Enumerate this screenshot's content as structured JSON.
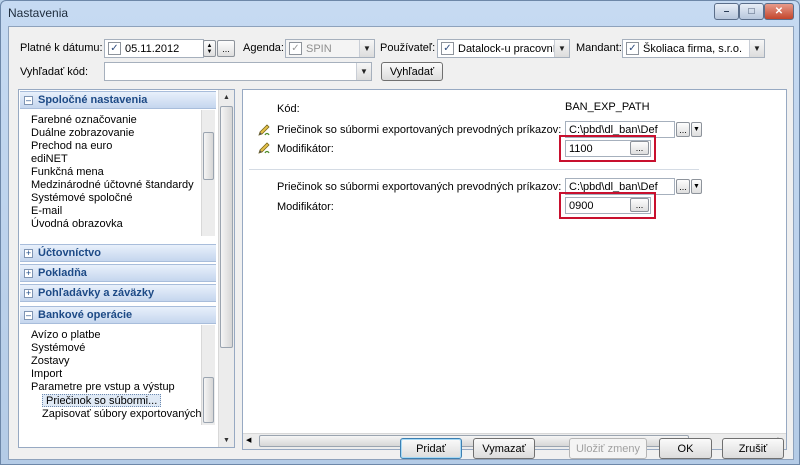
{
  "window": {
    "title": "Nastavenia"
  },
  "toolbar": {
    "valid_date_label": "Platné k dátumu:",
    "valid_date_value": "05.11.2012",
    "agenda_label": "Agenda:",
    "agenda_value": "SPIN",
    "user_label": "Používateľ:",
    "user_value": "Datalock-u pracovník",
    "mandant_label": "Mandant:",
    "mandant_value": "Školiaca firma, s.r.o.",
    "search_label": "Vyhľadať kód:",
    "search_value": "",
    "search_button": "Vyhľadať",
    "ellipsis": "..."
  },
  "nav": {
    "sections": [
      {
        "label": "Spoločné nastavenia",
        "expanded": true
      },
      {
        "label": "Účtovníctvo",
        "expanded": false
      },
      {
        "label": "Pokladňa",
        "expanded": false
      },
      {
        "label": "Pohľadávky a záväzky",
        "expanded": false
      },
      {
        "label": "Bankové operácie",
        "expanded": true
      }
    ],
    "common_items": [
      "Farebné označovanie",
      "Duálne zobrazovanie",
      "Prechod na euro",
      "ediNET",
      "Funkčná mena",
      "Medzinárodné účtovné štandardy",
      "Systémové spoločné",
      "E-mail",
      "Úvodná obrazovka"
    ],
    "bank_items": [
      "Avízo o platbe",
      "Systémové",
      "Zostavy",
      "Import",
      "Parametre pre vstup a výstup"
    ],
    "bank_subitems": [
      "Priečinok so súbormi...",
      "Zapisovať súbory exportovaných..."
    ]
  },
  "detail": {
    "code_label": "Kód:",
    "code_value": "BAN_EXP_PATH",
    "groups": [
      {
        "folder_label": "Priečinok so súbormi exportovaných prevodných príkazov:",
        "folder_value": "C:\\pbd\\dl_ban\\Def",
        "modifier_label": "Modifikátor:",
        "modifier_value": "1100"
      },
      {
        "folder_label": "Priečinok so súbormi exportovaných prevodných príkazov:",
        "folder_value": "C:\\pbd\\dl_ban\\Def",
        "modifier_label": "Modifikátor:",
        "modifier_value": "0900"
      }
    ]
  },
  "footer": {
    "add": "Pridať",
    "delete": "Vymazať",
    "save": "Uložiť zmeny",
    "ok": "OK",
    "cancel": "Zrušiť"
  },
  "colors": {
    "highlight_box": "#c8102e",
    "section_text": "#1d4a86"
  }
}
